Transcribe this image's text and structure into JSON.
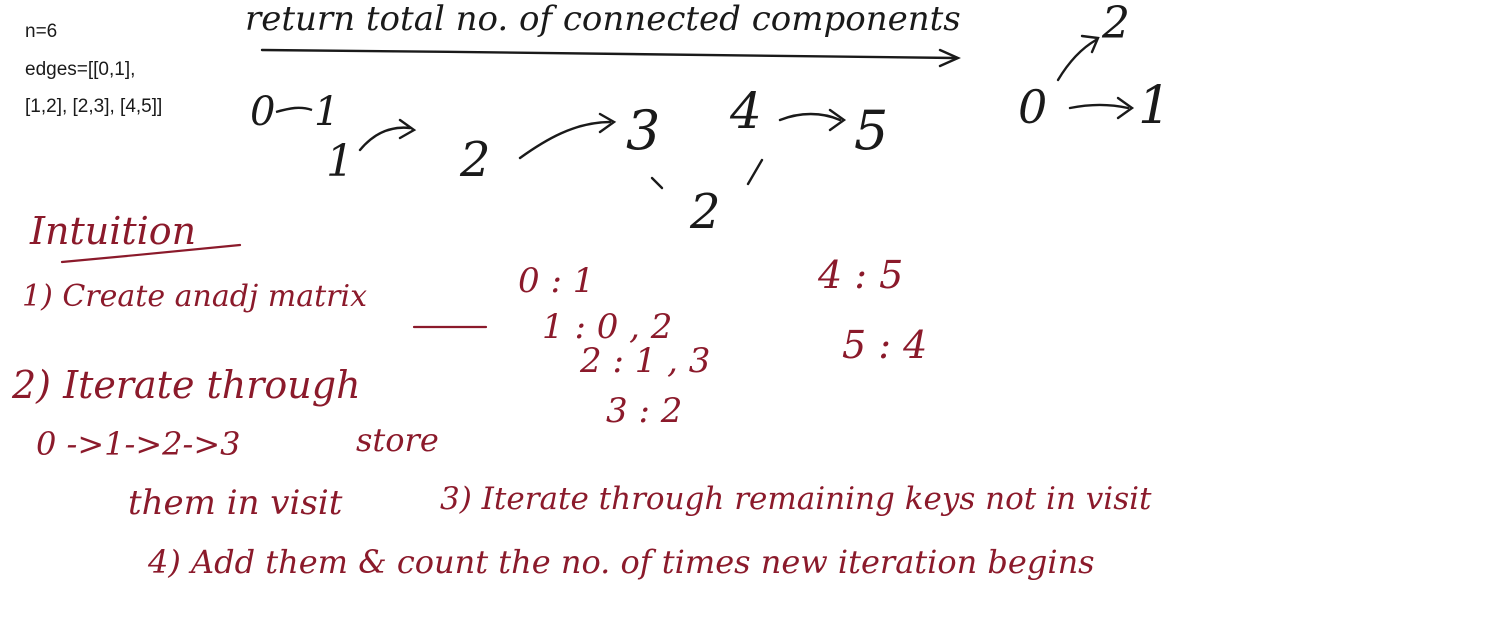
{
  "ink": {
    "black": "#1a1a1a",
    "red": "#8b1a2b"
  },
  "typed": {
    "n": "n=6",
    "edges_line1": "edges=[[0,1],",
    "edges_line2": "[1,2], [2,3], [4,5]]"
  },
  "title": "return total no. of connected components",
  "graph": {
    "c1": {
      "nodes": {
        "n0": "0",
        "n1": "1",
        "n2": "2",
        "n3": "3"
      },
      "edge_label": "2"
    },
    "c2": {
      "nodes": {
        "n4": "4",
        "n5": "5"
      }
    },
    "c3": {
      "nodes": {
        "n0": "0",
        "n1": "1",
        "n2": "2"
      }
    }
  },
  "intuition": {
    "heading": "Intuition",
    "step1": "1) Create anadj matrix",
    "step2": "2) Iterate through",
    "path": "0 ->1->2->3",
    "store": "store",
    "visit": "them in visit",
    "step3": "3) Iterate through remaining keys not in visit",
    "step4": "4) Add them & count the no. of times new iteration begins"
  },
  "adjacency": {
    "a0": "0 : 1",
    "a1": "1 : 0 , 2",
    "a2": "2 : 1 , 3",
    "a3": "3 : 2",
    "a4": "4 : 5",
    "a5": "5 : 4"
  }
}
